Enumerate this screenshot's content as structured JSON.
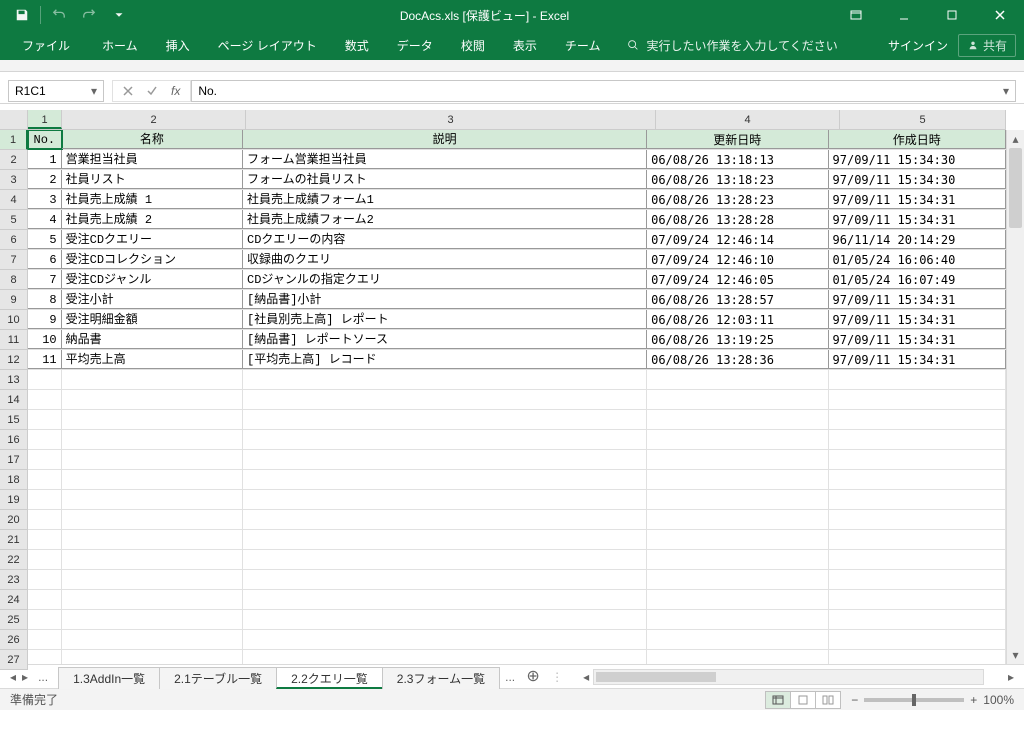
{
  "title": "DocAcs.xls  [保護ビュー] - Excel",
  "qat": {
    "save": "保存",
    "undo": "元に戻す",
    "redo": "やり直し"
  },
  "ribbon": {
    "file": "ファイル",
    "home": "ホーム",
    "insert": "挿入",
    "pagelayout": "ページ レイアウト",
    "formulas": "数式",
    "data": "データ",
    "review": "校閲",
    "view": "表示",
    "team": "チーム",
    "tellme": "実行したい作業を入力してください",
    "signin": "サインイン",
    "share": "共有"
  },
  "namebox": "R1C1",
  "formula": "No.",
  "cols": [
    "1",
    "2",
    "3",
    "4",
    "5"
  ],
  "headers": {
    "c1": "No.",
    "c2": "名称",
    "c3": "説明",
    "c4": "更新日時",
    "c5": "作成日時"
  },
  "rows": [
    {
      "n": "1",
      "name": "営業担当社員",
      "desc": "フォーム営業担当社員",
      "upd": "06/08/26 13:18:13",
      "crt": "97/09/11 15:34:30"
    },
    {
      "n": "2",
      "name": "社員リスト",
      "desc": "フォームの社員リスト",
      "upd": "06/08/26 13:18:23",
      "crt": "97/09/11 15:34:30"
    },
    {
      "n": "3",
      "name": "社員売上成績 1",
      "desc": "社員売上成績フォーム1",
      "upd": "06/08/26 13:28:23",
      "crt": "97/09/11 15:34:31"
    },
    {
      "n": "4",
      "name": "社員売上成績 2",
      "desc": "社員売上成績フォーム2",
      "upd": "06/08/26 13:28:28",
      "crt": "97/09/11 15:34:31"
    },
    {
      "n": "5",
      "name": "受注CDクエリー",
      "desc": "CDクエリーの内容",
      "upd": "07/09/24 12:46:14",
      "crt": "96/11/14 20:14:29"
    },
    {
      "n": "6",
      "name": "受注CDコレクション",
      "desc": "収録曲のクエリ",
      "upd": "07/09/24 12:46:10",
      "crt": "01/05/24 16:06:40"
    },
    {
      "n": "7",
      "name": "受注CDジャンル",
      "desc": "CDジャンルの指定クエリ",
      "upd": "07/09/24 12:46:05",
      "crt": "01/05/24 16:07:49"
    },
    {
      "n": "8",
      "name": "受注小計",
      "desc": "[納品書]小計",
      "upd": "06/08/26 13:28:57",
      "crt": "97/09/11 15:34:31"
    },
    {
      "n": "9",
      "name": "受注明細金額",
      "desc": "[社員別売上高] レポート",
      "upd": "06/08/26 12:03:11",
      "crt": "97/09/11 15:34:31"
    },
    {
      "n": "10",
      "name": "納品書",
      "desc": "[納品書] レポートソース",
      "upd": "06/08/26 13:19:25",
      "crt": "97/09/11 15:34:31"
    },
    {
      "n": "11",
      "name": "平均売上高",
      "desc": "[平均売上高] レコード",
      "upd": "06/08/26 13:28:36",
      "crt": "97/09/11 15:34:31"
    }
  ],
  "emptyrows": 15,
  "tabs": {
    "t1": "1.3AddIn一覧",
    "t2": "2.1テーブル一覧",
    "t3": "2.2クエリ一覧",
    "t4": "2.3フォーム一覧"
  },
  "status": {
    "ready": "準備完了",
    "zoom": "100%"
  }
}
